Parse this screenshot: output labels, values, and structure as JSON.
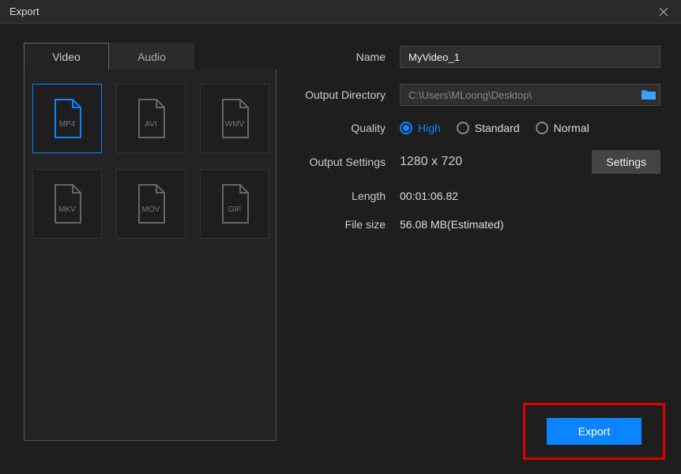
{
  "window": {
    "title": "Export"
  },
  "tabs": {
    "video": "Video",
    "audio": "Audio"
  },
  "formats": [
    {
      "label": "MP4",
      "active": true
    },
    {
      "label": "AVI",
      "active": false
    },
    {
      "label": "WMV",
      "active": false
    },
    {
      "label": "MKV",
      "active": false
    },
    {
      "label": "MOV",
      "active": false
    },
    {
      "label": "GIF",
      "active": false
    }
  ],
  "labels": {
    "name": "Name",
    "outputDir": "Output Directory",
    "quality": "Quality",
    "outputSettings": "Output Settings",
    "length": "Length",
    "fileSize": "File size"
  },
  "values": {
    "name": "MyVideo_1",
    "outputDir": "C:\\Users\\MLoong\\Desktop\\",
    "outputSettings": "1280 x 720",
    "length": "00:01:06.82",
    "fileSize": "56.08 MB(Estimated)"
  },
  "quality": {
    "options": {
      "high": "High",
      "standard": "Standard",
      "normal": "Normal"
    },
    "selected": "high"
  },
  "buttons": {
    "settings": "Settings",
    "export": "Export"
  },
  "colors": {
    "accent": "#0a84ff",
    "highlight": "#e00000",
    "bg": "#1e1e1e"
  }
}
